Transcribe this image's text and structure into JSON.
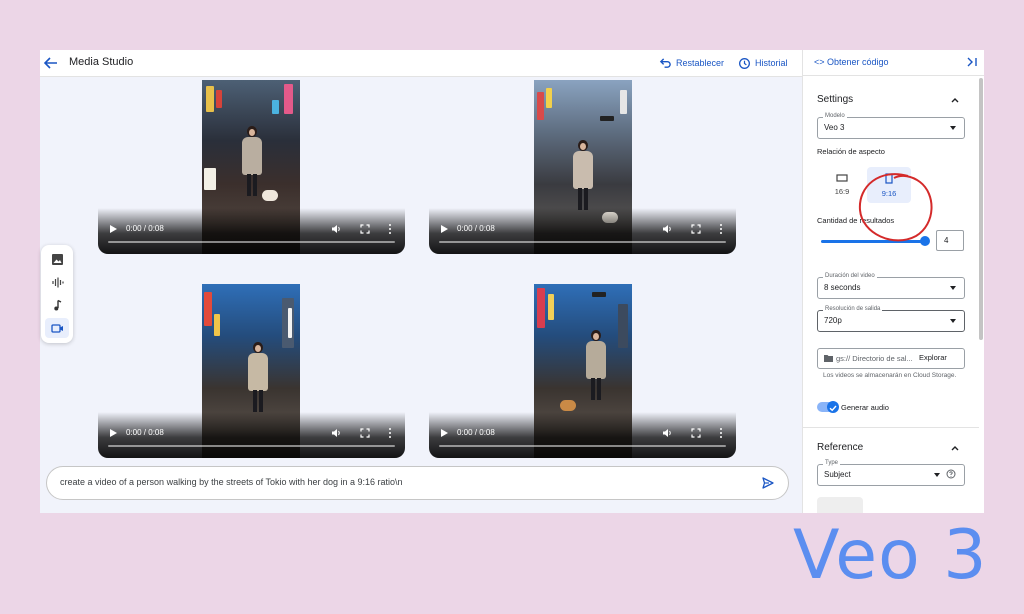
{
  "app": {
    "title": "Media Studio",
    "restore_label": "Restablecer",
    "history_label": "Historial"
  },
  "videos": [
    {
      "time": "0:00 / 0:08"
    },
    {
      "time": "0:00 / 0:08"
    },
    {
      "time": "0:00 / 0:08"
    },
    {
      "time": "0:00 / 0:08"
    }
  ],
  "tools": [
    {
      "icon": "image-icon"
    },
    {
      "icon": "audio-waveform-icon"
    },
    {
      "icon": "music-note-icon"
    },
    {
      "icon": "video-camera-icon",
      "active": true
    }
  ],
  "prompt": {
    "text": "create a video of a person walking by the streets of Tokio with her dog in a 9:16 ratio\\n"
  },
  "panel": {
    "code_link": "<> Obtener código",
    "settings_title": "Settings",
    "model_label": "Modelo",
    "model_value": "Veo 3",
    "aspect_title": "Relación de aspecto",
    "aspect_options": [
      "16:9",
      "9:16"
    ],
    "aspect_selected": "9:16",
    "count_label": "Cantidad de resultados",
    "count_value": "4",
    "duration_label": "Duración del video",
    "duration_value": "8 seconds",
    "resolution_label": "Resolución de salida",
    "resolution_value": "720p",
    "storage_placeholder": "gs:// Directorio de sal...",
    "explore_label": "Explorar",
    "storage_helper": "Los videos se almacenarán en Cloud Storage.",
    "audio_label": "Generar audio",
    "audio_on": true,
    "reference_title": "Reference",
    "type_label": "Type",
    "type_value": "Subject"
  },
  "watermark": "Veo 3",
  "colors": {
    "background": "#ecd6e7",
    "accent": "#1a56c4",
    "watermark": "#5b8ef0",
    "annotation": "#d42a2a"
  }
}
